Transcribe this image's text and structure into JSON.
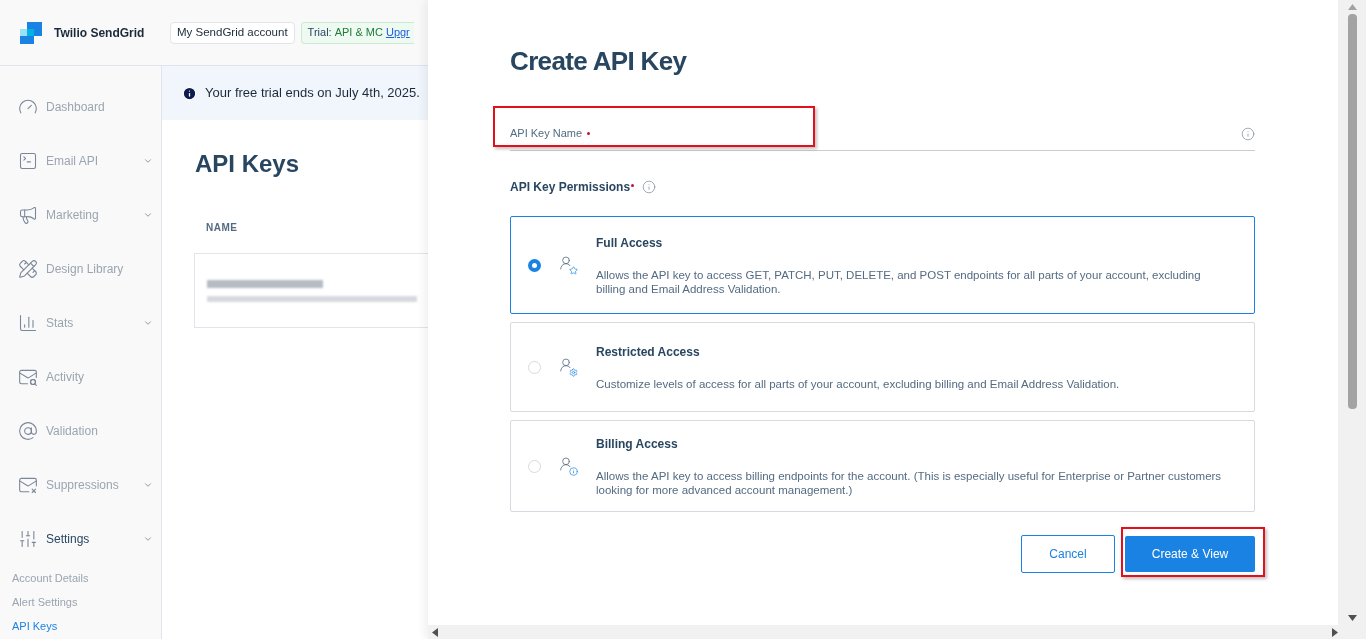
{
  "header": {
    "brand": "Twilio SendGrid",
    "account_button": "My SendGrid account",
    "trial": {
      "label": "Trial:",
      "plan": "API & MC",
      "link": "Upgr"
    }
  },
  "sidebar": {
    "items": [
      {
        "label": "Dashboard",
        "kind": "dashboard",
        "expandable": false,
        "selected": false
      },
      {
        "label": "Email API",
        "kind": "email-api",
        "expandable": true,
        "selected": false
      },
      {
        "label": "Marketing",
        "kind": "marketing",
        "expandable": true,
        "selected": false
      },
      {
        "label": "Design Library",
        "kind": "design",
        "expandable": false,
        "selected": false
      },
      {
        "label": "Stats",
        "kind": "stats",
        "expandable": true,
        "selected": false
      },
      {
        "label": "Activity",
        "kind": "activity",
        "expandable": false,
        "selected": false
      },
      {
        "label": "Validation",
        "kind": "validation",
        "expandable": false,
        "selected": false
      },
      {
        "label": "Suppressions",
        "kind": "suppressions",
        "expandable": true,
        "selected": false
      },
      {
        "label": "Settings",
        "kind": "settings",
        "expandable": true,
        "selected": true
      }
    ],
    "sub_items": [
      {
        "label": "Account Details",
        "selected": false
      },
      {
        "label": "Alert Settings",
        "selected": false
      },
      {
        "label": "API Keys",
        "selected": true
      }
    ]
  },
  "banner": "Your free trial ends on July 4th, 2025.",
  "page_title": "API Keys",
  "table": {
    "columns": [
      "NAME"
    ]
  },
  "drawer": {
    "title": "Create API Key",
    "name_field": {
      "label": "API Key Name",
      "required": true,
      "highlighted": true
    },
    "permissions_label": "API Key Permissions",
    "options": [
      {
        "kind": "full",
        "title": "Full Access",
        "description": "Allows the API key to access GET, PATCH, PUT, DELETE, and POST endpoints for all parts of your account, excluding billing and Email Address Validation.",
        "selected": true
      },
      {
        "kind": "restricted",
        "title": "Restricted Access",
        "description": "Customize levels of access for all parts of your account, excluding billing and Email Address Validation.",
        "selected": false
      },
      {
        "kind": "billing",
        "title": "Billing Access",
        "description": "Allows the API key to access billing endpoints for the account. (This is especially useful for Enterprise or Partner customers looking for more advanced account management.)",
        "selected": false
      }
    ],
    "cancel_button": "Cancel",
    "create_button": {
      "label": "Create & View",
      "highlighted": true
    }
  }
}
